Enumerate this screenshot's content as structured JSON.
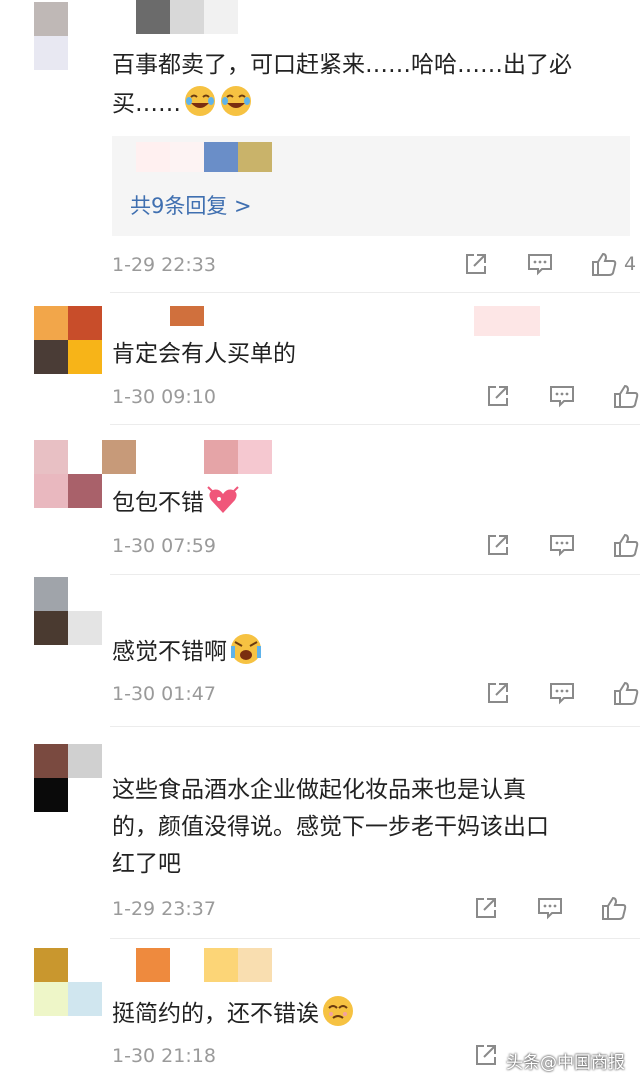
{
  "comments": [
    {
      "text_lines": [
        "百事都卖了，可口赶紧来……哈哈……出了必",
        "买……"
      ],
      "time": "1-29 22:33",
      "likes": "4",
      "reply_link": "共9条回复 >",
      "emoji": [
        "laughing-tears-emoji",
        "laughing-tears-emoji"
      ]
    },
    {
      "text_lines": [
        "肯定会有人买单的"
      ],
      "time": "1-30 09:10",
      "likes": ""
    },
    {
      "text_lines": [
        "包包不错"
      ],
      "time": "1-30 07:59",
      "likes": "",
      "emoji": [
        "hearts-emoji"
      ]
    },
    {
      "text_lines": [
        "感觉不错啊"
      ],
      "time": "1-30 01:47",
      "likes": "",
      "emoji": [
        "crying-emoji"
      ]
    },
    {
      "text_lines": [
        "这些食品酒水企业做起化妆品来也是认真",
        "的，颜值没得说。感觉下一步老干妈该出口",
        "红了吧"
      ],
      "time": "1-29 23:37",
      "likes": ""
    },
    {
      "text_lines": [
        "挺简约的，还不错诶"
      ],
      "time": "1-30 21:18",
      "likes": "",
      "emoji": [
        "moved-emoji"
      ]
    }
  ],
  "watermark": "头条@中国商报",
  "colors": {
    "link": "#3f6fb0",
    "meta": "#9a9a9a",
    "reply_bg": "#f5f5f5"
  },
  "icons": [
    "share-icon",
    "comment-icon",
    "like-icon"
  ]
}
